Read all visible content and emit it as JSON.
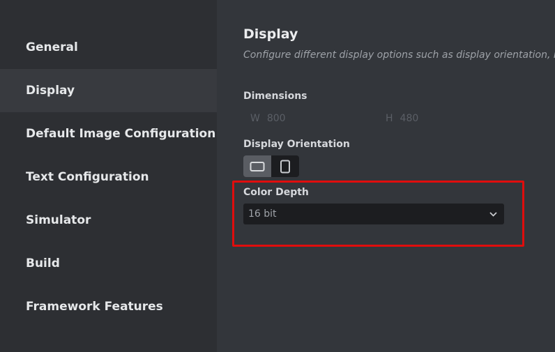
{
  "sidebar": {
    "items": [
      {
        "label": "General",
        "active": false
      },
      {
        "label": "Display",
        "active": true
      },
      {
        "label": "Default Image Configuration",
        "active": false
      },
      {
        "label": "Text Configuration",
        "active": false
      },
      {
        "label": "Simulator",
        "active": false
      },
      {
        "label": "Build",
        "active": false
      },
      {
        "label": "Framework Features",
        "active": false
      }
    ]
  },
  "main": {
    "title": "Display",
    "description": "Configure different display options such as display orientation, re",
    "dimensions": {
      "label": "Dimensions",
      "width_prefix": "W",
      "width_value": "800",
      "height_prefix": "H",
      "height_value": "480"
    },
    "orientation": {
      "label": "Display Orientation",
      "options": [
        "landscape-icon",
        "portrait-icon"
      ],
      "selected": "landscape"
    },
    "color_depth": {
      "label": "Color Depth",
      "selected": "16 bit"
    }
  },
  "colors": {
    "highlight": "#e00d0d",
    "sidebar_bg": "#2d2f33",
    "main_bg": "#33363b",
    "active_item_bg": "#383a3f"
  }
}
